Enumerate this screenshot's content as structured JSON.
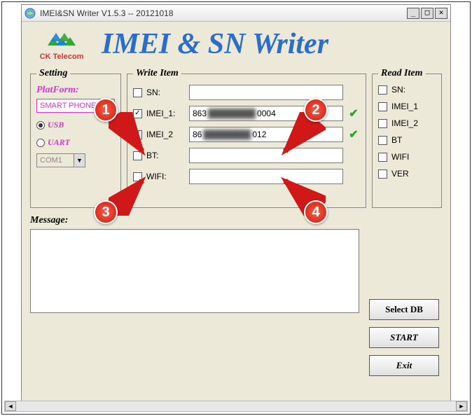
{
  "window": {
    "title": "IMEI&SN Writer V1.5.3 -- 20121018"
  },
  "logo": {
    "brand": "CK Telecom"
  },
  "app_title": "IMEI & SN Writer",
  "setting": {
    "legend": "Setting",
    "platform_label": "PlatForm:",
    "platform_value": "SMART PHONE",
    "conn_usb": "USB",
    "conn_uart": "UART",
    "com_value": "COM1"
  },
  "write": {
    "legend": "Write Item",
    "sn_label": "SN:",
    "sn_value": "",
    "sn_checked": false,
    "imei1_label": "IMEI_1:",
    "imei1_prefix": "863",
    "imei1_hidden": "████████",
    "imei1_suffix": "0004",
    "imei1_checked": true,
    "imei1_valid": true,
    "imei2_label": "IMEI_2",
    "imei2_prefix": "86",
    "imei2_hidden": "████████",
    "imei2_suffix": "012",
    "imei2_checked": true,
    "imei2_valid": true,
    "bt_label": "BT:",
    "bt_value": "",
    "bt_checked": false,
    "wifi_label": "WIFI:",
    "wifi_value": "",
    "wifi_checked": false
  },
  "read": {
    "legend": "Read Item",
    "sn": "SN:",
    "imei1": "IMEI_1",
    "imei2": "IMEI_2",
    "bt": "BT",
    "wifi": "WIFI",
    "ver": "VER"
  },
  "message_label": "Message:",
  "buttons": {
    "select_db": "Select DB",
    "start": "START",
    "exit": "Exit"
  },
  "annotations": {
    "b1": "1",
    "b2": "2",
    "b3": "3",
    "b4": "4"
  }
}
